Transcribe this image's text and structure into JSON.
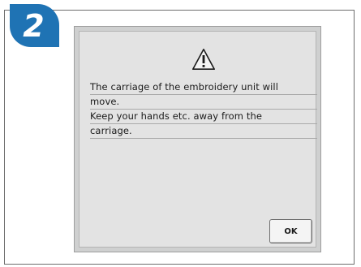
{
  "step": {
    "number": "2",
    "color": "#1f73b4"
  },
  "dialog": {
    "icon": "warning-triangle-icon",
    "message_lines": [
      "The carriage of the embroidery unit will",
      "move.",
      "Keep your hands etc. away from the",
      "carriage."
    ],
    "ok_label": "OK"
  }
}
